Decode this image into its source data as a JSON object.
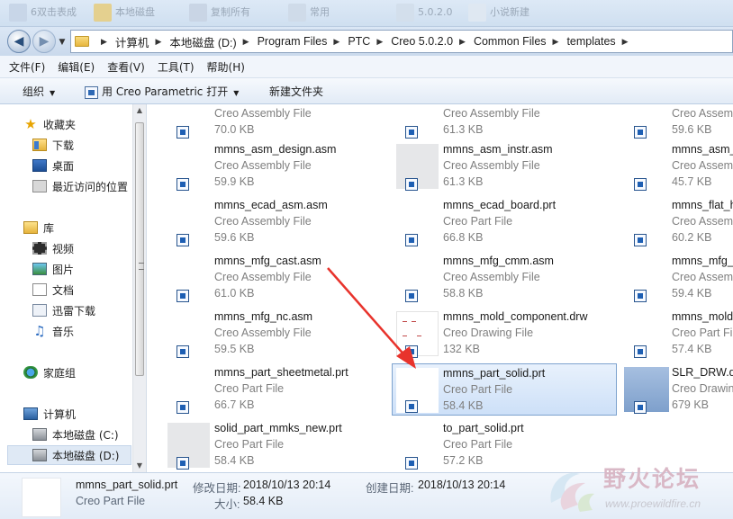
{
  "window": {
    "top_strip": [
      {
        "label": "6双击表成"
      },
      {
        "label": "本地磁盘"
      },
      {
        "label": "复制所有"
      },
      {
        "label": "常用"
      },
      {
        "label": "5.0.2.0"
      },
      {
        "label": "小说新建"
      }
    ]
  },
  "address_bar": {
    "crumbs": [
      "计算机",
      "本地磁盘 (D:)",
      "Program Files",
      "PTC",
      "Creo 5.0.2.0",
      "Common Files",
      "templates"
    ]
  },
  "menu": {
    "items": [
      "文件(F)",
      "编辑(E)",
      "查看(V)",
      "工具(T)",
      "帮助(H)"
    ]
  },
  "toolbar": {
    "organize": "组织",
    "open_with": "用 Creo Parametric 打开",
    "new_folder": "新建文件夹"
  },
  "nav": {
    "favorites": "收藏夹",
    "downloads": "下载",
    "desktop": "桌面",
    "recent": "最近访问的位置",
    "libraries": "库",
    "videos": "视频",
    "pictures": "图片",
    "documents": "文档",
    "xunlei": "迅雷下载",
    "music": "音乐",
    "homegroup": "家庭组",
    "computer": "计算机",
    "drive_c": "本地磁盘 (C:)",
    "drive_d": "本地磁盘 (D:)"
  },
  "files": {
    "col1": [
      {
        "name": "",
        "type": "Creo Assembly File",
        "size": "70.0 KB"
      },
      {
        "name": "mmns_asm_design.asm",
        "type": "Creo Assembly File",
        "size": "59.9 KB"
      },
      {
        "name": "mmns_ecad_asm.asm",
        "type": "Creo Assembly File",
        "size": "59.6 KB"
      },
      {
        "name": "mmns_mfg_cast.asm",
        "type": "Creo Assembly File",
        "size": "61.0 KB"
      },
      {
        "name": "mmns_mfg_nc.asm",
        "type": "Creo Assembly File",
        "size": "59.5 KB"
      },
      {
        "name": "mmns_part_sheetmetal.prt",
        "type": "Creo Part File",
        "size": "66.7 KB"
      },
      {
        "name": "solid_part_mmks_new.prt",
        "type": "Creo Part File",
        "size": "58.4 KB"
      }
    ],
    "col2": [
      {
        "name": "",
        "type": "Creo Assembly File",
        "size": "61.3 KB"
      },
      {
        "name": "mmns_asm_instr.asm",
        "type": "Creo Assembly File",
        "size": "61.3 KB"
      },
      {
        "name": "mmns_ecad_board.prt",
        "type": "Creo Part File",
        "size": "66.8 KB"
      },
      {
        "name": "mmns_mfg_cmm.asm",
        "type": "Creo Assembly File",
        "size": "58.8 KB"
      },
      {
        "name": "mmns_mold_component.drw",
        "type": "Creo Drawing File",
        "size": "132 KB"
      },
      {
        "name": "mmns_part_solid.prt",
        "type": "Creo Part File",
        "size": "58.4 KB"
      },
      {
        "name": "to_part_solid.prt",
        "type": "Creo Part File",
        "size": "57.2 KB"
      }
    ],
    "col3": [
      {
        "name": "",
        "type": "Creo Assem",
        "size": "59.6 KB"
      },
      {
        "name": "mmns_asm_",
        "type": "Creo Assem",
        "size": "45.7 KB"
      },
      {
        "name": "mmns_flat_h",
        "type": "Creo Assem",
        "size": "60.2 KB"
      },
      {
        "name": "mmns_mfg_",
        "type": "Creo Assem",
        "size": "59.4 KB"
      },
      {
        "name": "mmns_mold",
        "type": "Creo Part Fi",
        "size": "57.4 KB"
      },
      {
        "name": "SLR_DRW.dr",
        "type": "Creo Drawin",
        "size": "679 KB"
      }
    ]
  },
  "details": {
    "name": "mmns_part_solid.prt",
    "type": "Creo Part File",
    "modified_label": "修改日期:",
    "modified": "2018/10/13 20:14",
    "size_label": "大小:",
    "size": "58.4 KB",
    "created_label": "创建日期:",
    "created": "2018/10/13 20:14"
  },
  "watermark": {
    "title": "野火论坛",
    "url": "www.proewildfire.cn"
  },
  "colors": {
    "selection": "#cde0f8",
    "arrow": "#e8332c",
    "accent": "#1e5fb3"
  }
}
